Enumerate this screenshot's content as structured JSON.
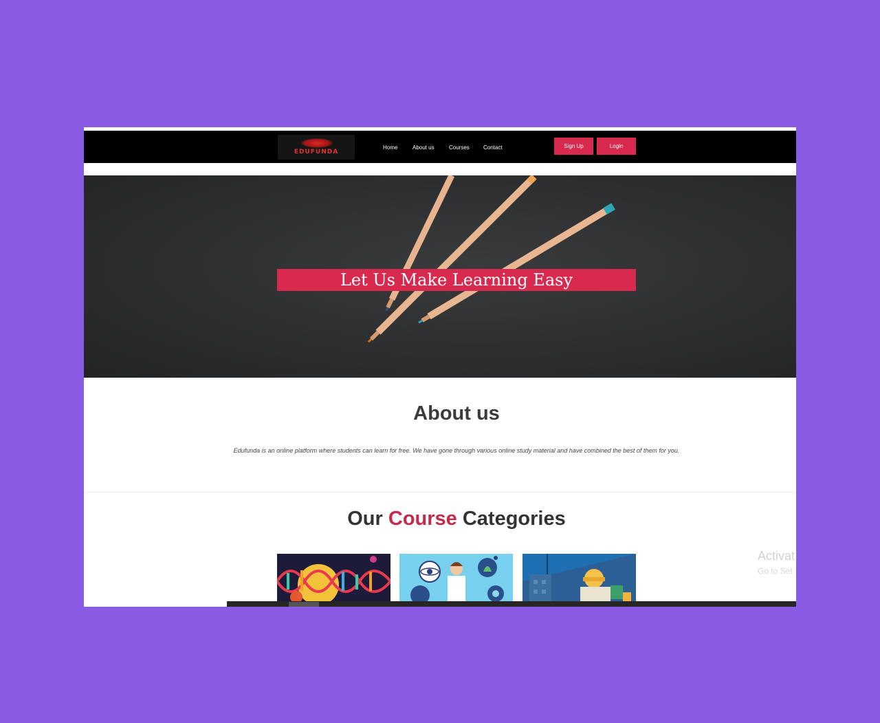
{
  "brand": {
    "logo_text": "EDUFUNDA"
  },
  "nav": {
    "links": [
      "Home",
      "About us",
      "Courses",
      "Contact"
    ],
    "signup_label": "Sign Up",
    "login_label": "Login"
  },
  "hero": {
    "headline": "Let Us Make Learning Easy"
  },
  "about": {
    "title": "About us",
    "text": "Edufunda is an online platform where students can learn for free. We have gone through various online study material and have combined the best of them for you."
  },
  "categories": {
    "title_part1": "Our",
    "title_accent": "Course",
    "title_part2": "Categories",
    "cards": [
      {
        "icon": "dna-biology-illustration"
      },
      {
        "icon": "scientist-illustration"
      },
      {
        "icon": "engineering-illustration"
      }
    ]
  },
  "watermark": {
    "line1": "Activat",
    "line2": "Go to Set"
  },
  "colors": {
    "page_background": "#8a5ce3",
    "accent": "#d8294f",
    "navbar": "#000000"
  }
}
